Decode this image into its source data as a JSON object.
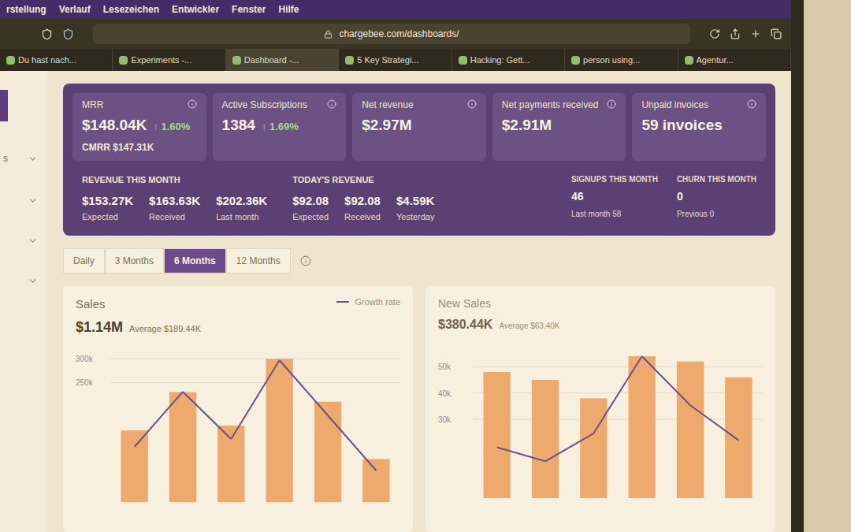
{
  "menubar": {
    "items": [
      "rstellung",
      "Verlauf",
      "Lesezeichen",
      "Entwickler",
      "Fenster",
      "Hilfe"
    ]
  },
  "browser": {
    "url": "chargebee.com/dashboards/",
    "tabs": [
      {
        "label": "Du hast nach...",
        "selected": false
      },
      {
        "label": "Experiments -...",
        "selected": false
      },
      {
        "label": "Dashboard -...",
        "selected": true
      },
      {
        "label": "5 Key Strategi...",
        "selected": false
      },
      {
        "label": "Hacking: Gett...",
        "selected": false
      },
      {
        "label": "person using...",
        "selected": false
      },
      {
        "label": "Agentur...",
        "selected": false
      }
    ]
  },
  "sidebar": {
    "items": [
      {
        "label": "s"
      }
    ]
  },
  "kpis": [
    {
      "label": "MRR",
      "value": "$148.04K",
      "change": "↑ 1.60%",
      "sub": "CMRR $147.31K"
    },
    {
      "label": "Active Subscriptions",
      "value": "1384",
      "change": "↑ 1.69%"
    },
    {
      "label": "Net revenue",
      "value": "$2.97M"
    },
    {
      "label": "Net payments received",
      "value": "$2.91M"
    },
    {
      "label": "Unpaid invoices",
      "value": "59 invoices"
    }
  ],
  "revenue_this_month": {
    "title": "REVENUE THIS MONTH",
    "items": [
      {
        "value": "$153.27K",
        "label": "Expected"
      },
      {
        "value": "$163.63K",
        "label": "Received"
      },
      {
        "value": "$202.36K",
        "label": "Last month"
      }
    ]
  },
  "todays_revenue": {
    "title": "TODAY'S REVENUE",
    "items": [
      {
        "value": "$92.08",
        "label": "Expected"
      },
      {
        "value": "$92.08",
        "label": "Received"
      },
      {
        "value": "$4.59K",
        "label": "Yesterday"
      }
    ]
  },
  "side_stats": [
    {
      "label": "SIGNUPS THIS MONTH",
      "value": "46",
      "sub": "Last month 58"
    },
    {
      "label": "CHURN THIS MONTH",
      "value": "0",
      "sub": "Previous 0"
    }
  ],
  "range_tabs": [
    {
      "label": "Daily",
      "selected": false
    },
    {
      "label": "3 Months",
      "selected": false
    },
    {
      "label": "6 Months",
      "selected": true
    },
    {
      "label": "12 Months",
      "selected": false
    }
  ],
  "sales_chart": {
    "title": "Sales",
    "total": "$1.14M",
    "average": "Average $189.44K",
    "legend": "Growth rate",
    "ticks": [
      "300k",
      "250k"
    ],
    "max": 330,
    "sales": [
      150,
      230,
      160,
      300,
      210,
      90
    ],
    "growth": [
      -30,
      40,
      -20,
      80,
      10,
      -60
    ]
  },
  "new_sales_chart": {
    "title": "New Sales",
    "total": "$380.44K",
    "average": "Average $63.40K",
    "ticks": [
      "50k",
      "40k",
      "30k"
    ],
    "max": 60,
    "new_sales": [
      48,
      45,
      38,
      54,
      52,
      46
    ],
    "growth": [
      -40,
      -60,
      -20,
      90,
      20,
      -30
    ]
  }
}
